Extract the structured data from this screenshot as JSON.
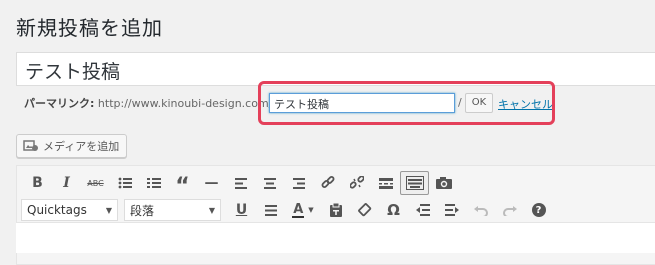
{
  "page": {
    "title": "新規投稿を追加"
  },
  "post": {
    "title": "テスト投稿"
  },
  "permalink": {
    "label": "パーマリンク:",
    "base_url": "http://www.kinoubi-design.com/",
    "slug": "テスト投稿",
    "slash": "/",
    "ok_label": "OK",
    "cancel_label": "キャンセル"
  },
  "media": {
    "add_label": "メディアを追加"
  },
  "toolbar": {
    "row1": [
      "bold-icon",
      "italic-icon",
      "strikethrough-icon",
      "bullet-list-icon",
      "numbered-list-icon",
      "blockquote-icon",
      "horizontal-rule-icon",
      "align-left-icon",
      "align-center-icon",
      "align-right-icon",
      "link-icon",
      "unlink-icon",
      "read-more-icon",
      "toolbar-toggle-icon",
      "camera-icon"
    ],
    "format_select": "Quicktags",
    "paragraph_select": "段落",
    "row2": [
      "underline-icon",
      "justify-icon",
      "text-color-icon",
      "paste-text-icon",
      "clear-format-icon",
      "special-character-icon",
      "outdent-icon",
      "indent-icon",
      "undo-icon",
      "redo-icon",
      "help-icon"
    ],
    "glyphs": {
      "bold": "B",
      "italic": "I",
      "strike": "ABC",
      "quote": "“",
      "hr": "—",
      "omega": "Ω",
      "underline": "U",
      "color": "A",
      "help": "?"
    }
  },
  "colors": {
    "highlight": "#e4405a",
    "link": "#0073aa"
  }
}
